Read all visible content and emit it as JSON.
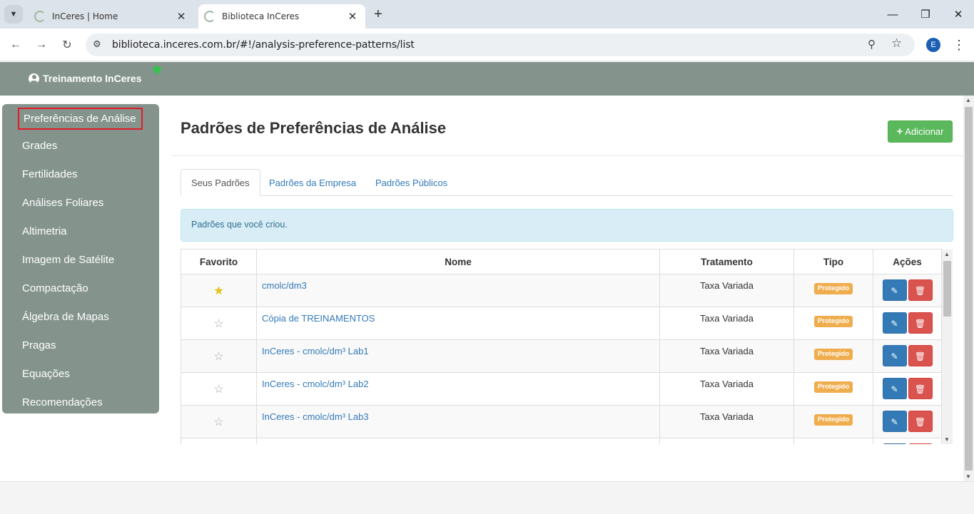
{
  "browser": {
    "tabs": [
      {
        "title": "InCeres | Home",
        "active": false
      },
      {
        "title": "Biblioteca InCeres",
        "active": true
      }
    ],
    "url": "biblioteca.inceres.com.br/#!/analysis-preference-patterns/list",
    "profile_initial": "E"
  },
  "header": {
    "user_name": "Treinamento InCeres"
  },
  "sidebar": {
    "items": [
      {
        "label": "Preferências de Análise"
      },
      {
        "label": "Grades"
      },
      {
        "label": "Fertilidades"
      },
      {
        "label": "Análises Foliares"
      },
      {
        "label": "Altimetria"
      },
      {
        "label": "Imagem de Satélite"
      },
      {
        "label": "Compactação"
      },
      {
        "label": "Álgebra de Mapas"
      },
      {
        "label": "Pragas"
      },
      {
        "label": "Equações"
      },
      {
        "label": "Recomendações"
      }
    ]
  },
  "main": {
    "title": "Padrões de Preferências de Análise",
    "add_label": "Adicionar",
    "tabs": [
      {
        "label": "Seus Padrões"
      },
      {
        "label": "Padrões da Empresa"
      },
      {
        "label": "Padrões Públicos"
      }
    ],
    "info": "Padrões que você criou.",
    "table": {
      "headers": [
        "Favorito",
        "Nome",
        "Tratamento",
        "Tipo",
        "Ações"
      ],
      "rows": [
        {
          "favorite": true,
          "name": "cmolc/dm3",
          "treatment": "Taxa Variada",
          "type": "Protegido"
        },
        {
          "favorite": false,
          "name": "Cópia de TREINAMENTOS",
          "treatment": "Taxa Variada",
          "type": "Protegido"
        },
        {
          "favorite": false,
          "name": "InCeres - cmolc/dm³ Lab1",
          "treatment": "Taxa Variada",
          "type": "Protegido"
        },
        {
          "favorite": false,
          "name": "InCeres - cmolc/dm³ Lab2",
          "treatment": "Taxa Variada",
          "type": "Protegido"
        },
        {
          "favorite": false,
          "name": "InCeres - cmolc/dm³ Lab3",
          "treatment": "Taxa Variada",
          "type": "Protegido"
        }
      ]
    }
  },
  "colors": {
    "header_bg": "#84948d",
    "primary": "#337ab7",
    "success": "#5cb85c",
    "danger": "#d9534f",
    "warning": "#f0ad4e",
    "highlight_border": "#e01b24"
  }
}
